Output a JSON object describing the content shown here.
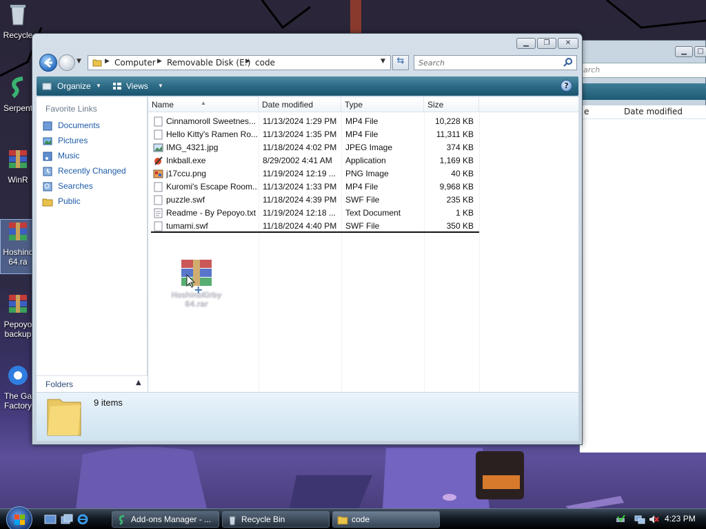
{
  "desktop": {
    "icons": [
      {
        "label": "Recycle"
      },
      {
        "label": "Serpent"
      },
      {
        "label": "WinR"
      },
      {
        "label": "Hoshinc\n64.ra"
      },
      {
        "label": "Pepoyo\nbackup"
      },
      {
        "label": "The Ga\nFactory"
      }
    ]
  },
  "background_window": {
    "search_placeholder": "arch",
    "col_partial": "e",
    "col_date": "Date modified"
  },
  "window": {
    "address": {
      "crumbs": [
        "Computer",
        "Removable Disk (E:)",
        "code"
      ]
    },
    "search_placeholder": "Search",
    "toolbar": {
      "organize": "Organize",
      "views": "Views"
    },
    "nav": {
      "header": "Favorite Links",
      "items": [
        "Documents",
        "Pictures",
        "Music",
        "Recently Changed",
        "Searches",
        "Public"
      ],
      "folders_label": "Folders"
    },
    "columns": [
      "Name",
      "Date modified",
      "Type",
      "Size"
    ],
    "files": [
      {
        "name": "Cinnamoroll Sweetnes...",
        "date": "11/13/2024 1:29 PM",
        "type": "MP4 File",
        "size": "10,228 KB",
        "icon": "video-file-icon"
      },
      {
        "name": "Hello Kitty's Ramen Ro...",
        "date": "11/13/2024 1:35 PM",
        "type": "MP4 File",
        "size": "11,311 KB",
        "icon": "video-file-icon"
      },
      {
        "name": "IMG_4321.jpg",
        "date": "11/18/2024 4:02 PM",
        "type": "JPEG Image",
        "size": "374 KB",
        "icon": "image-file-icon"
      },
      {
        "name": "Inkball.exe",
        "date": "8/29/2002 4:41 AM",
        "type": "Application",
        "size": "1,169 KB",
        "icon": "inkball-app-icon"
      },
      {
        "name": "j17ccu.png",
        "date": "11/19/2024 12:19 ...",
        "type": "PNG Image",
        "size": "40 KB",
        "icon": "png-file-icon"
      },
      {
        "name": "Kuromi's Escape Room...",
        "date": "11/13/2024 1:33 PM",
        "type": "MP4 File",
        "size": "9,968 KB",
        "icon": "video-file-icon"
      },
      {
        "name": "puzzle.swf",
        "date": "11/18/2024 4:39 PM",
        "type": "SWF File",
        "size": "235 KB",
        "icon": "swf-file-icon"
      },
      {
        "name": "Readme - By Pepoyo.txt",
        "date": "11/19/2024 12:18 ...",
        "type": "Text Document",
        "size": "1 KB",
        "icon": "text-file-icon"
      },
      {
        "name": "tumami.swf",
        "date": "11/18/2024 4:40 PM",
        "type": "SWF File",
        "size": "350 KB",
        "icon": "swf-file-icon"
      }
    ],
    "drag_label": "HoshinoKirby\n64.rar",
    "drag_badge": "+",
    "details": {
      "count": "9 items"
    }
  },
  "taskbar": {
    "tasks": [
      {
        "label": "Add-ons Manager - ..."
      },
      {
        "label": "Recycle Bin"
      },
      {
        "label": "code"
      }
    ],
    "clock": "4:23 PM"
  },
  "colors": {
    "link": "#1d5aa8",
    "toolbar": "#2d6a85",
    "taskbar": "#121a24"
  }
}
